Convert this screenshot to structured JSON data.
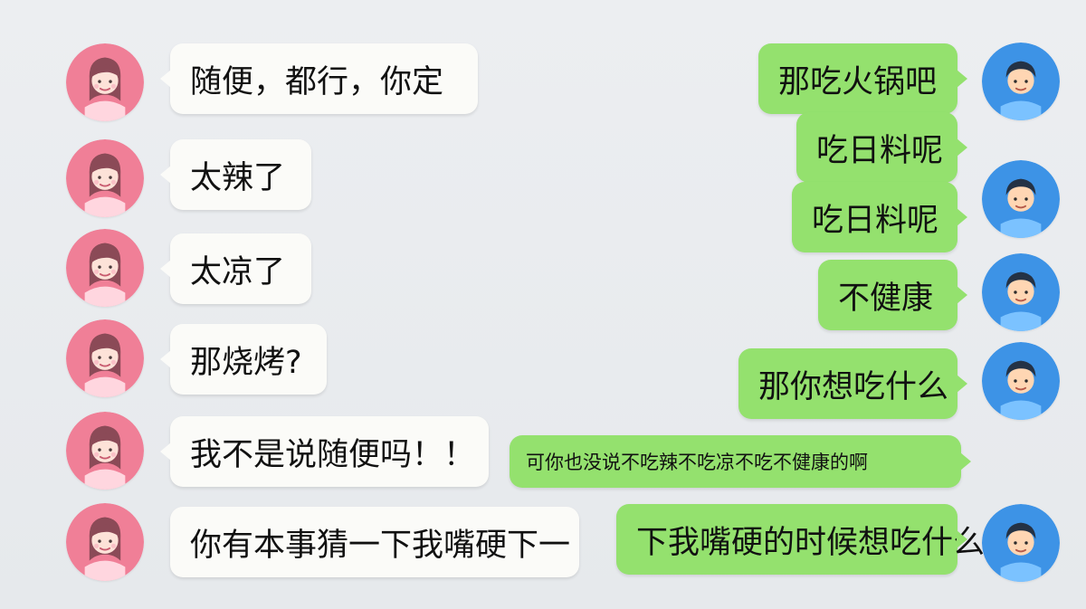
{
  "left_messages": [
    "随便，都行，你定",
    "太辣了",
    "太凉了",
    "那烧烤?",
    "我不是说随便吗！！",
    "你有本事猜一下我嘴硬下一"
  ],
  "right_messages": [
    "那吃火锅吧",
    "吃日料呢",
    "吃日料呢",
    "不健康",
    "那你想吃什么",
    "可你也没说不吃辣不吃凉不吃不健康的啊",
    "下我嘴硬的时候想吃什么"
  ],
  "colors": {
    "background": "#e9ebee",
    "left_bubble": "#fbfbf8",
    "right_bubble": "#94e16e",
    "female_avatar": "#f07f97",
    "male_avatar": "#3d93e6"
  }
}
